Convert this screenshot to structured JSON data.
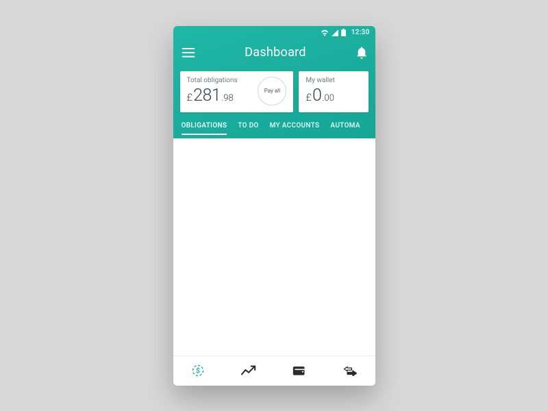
{
  "statusbar": {
    "time": "12:30"
  },
  "appbar": {
    "title": "Dashboard"
  },
  "cards": {
    "obligations": {
      "label": "Total obligations",
      "currency": "£",
      "amount_int": "281",
      "amount_dec": ".98",
      "pay_all_label": "Pay all"
    },
    "wallet": {
      "label": "My wallet",
      "currency": "£",
      "amount_int": "0",
      "amount_dec": ".00"
    }
  },
  "tabs": [
    {
      "label": "OBLIGATIONS",
      "active": true
    },
    {
      "label": "TO DO"
    },
    {
      "label": "MY ACCOUNTS"
    },
    {
      "label": "AUTOMA"
    }
  ],
  "colors": {
    "brand": "#1fb7a6"
  }
}
